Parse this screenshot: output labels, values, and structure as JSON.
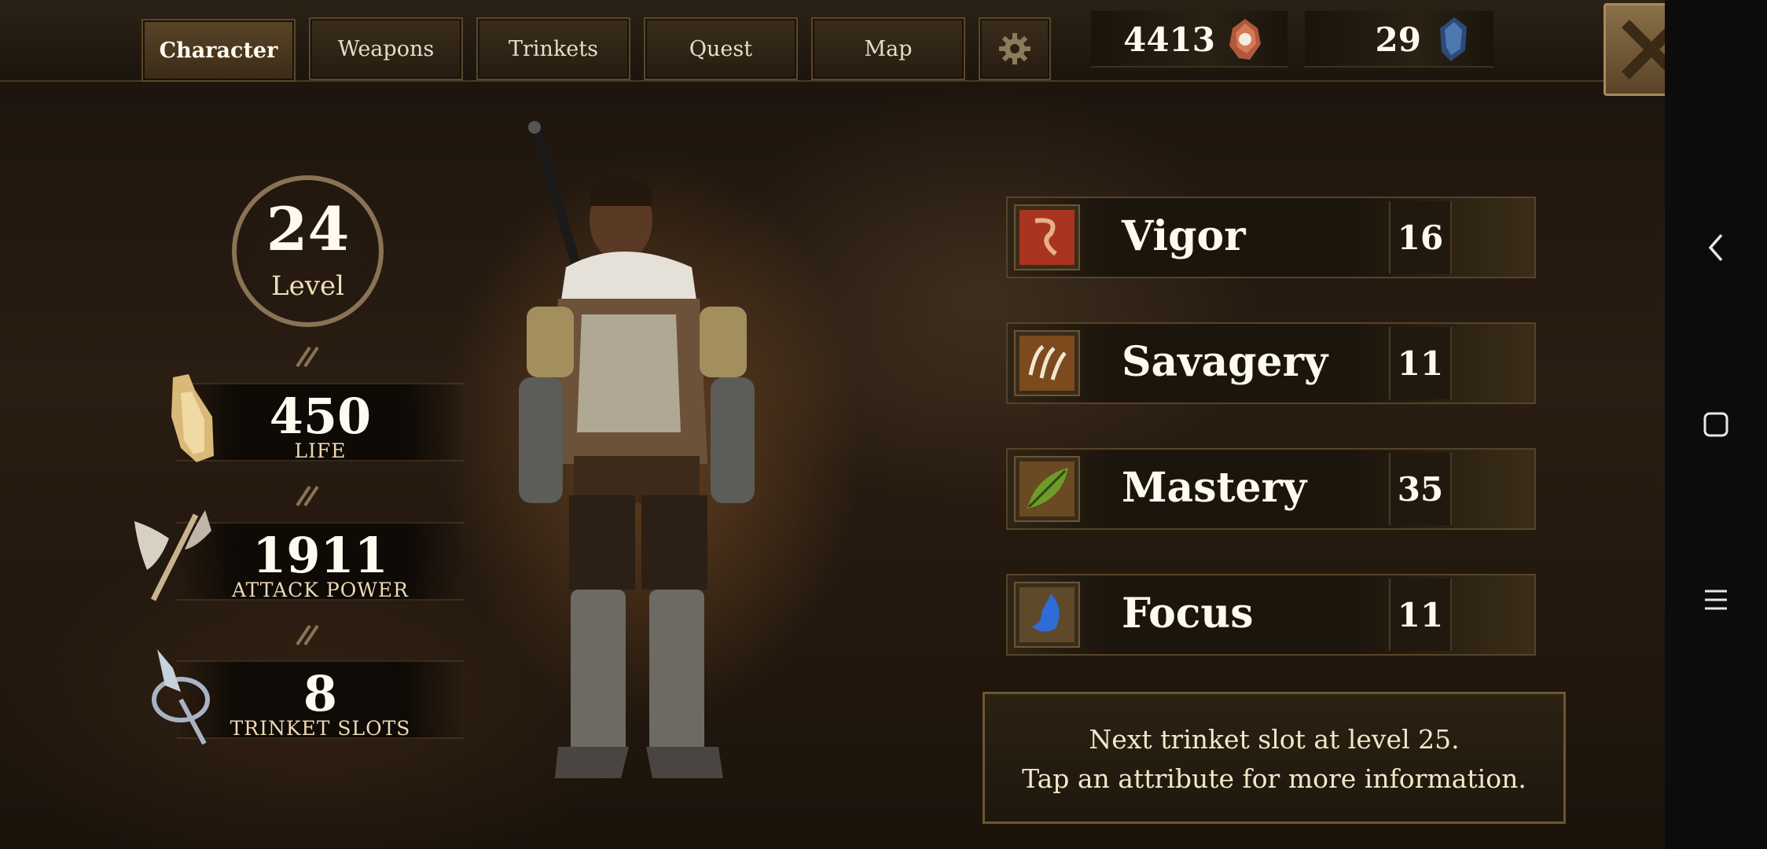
{
  "tabs": [
    {
      "label": "Character",
      "active": true
    },
    {
      "label": "Weapons",
      "active": false
    },
    {
      "label": "Trinkets",
      "active": false
    },
    {
      "label": "Quest",
      "active": false
    },
    {
      "label": "Map",
      "active": false
    }
  ],
  "currencies": {
    "gems": {
      "value": "4413",
      "icon": "red-gem-icon"
    },
    "crystals": {
      "value": "29",
      "icon": "blue-crystal-icon"
    }
  },
  "level": {
    "value": "24",
    "label": "Level"
  },
  "stats": [
    {
      "value": "450",
      "label": "LIFE",
      "icon": "gauntlet-icon"
    },
    {
      "value": "1911",
      "label": "ATTACK POWER",
      "icon": "axe-icon"
    },
    {
      "value": "8",
      "label": "TRINKET SLOTS",
      "icon": "trinket-icon"
    }
  ],
  "attributes": [
    {
      "name": "Vigor",
      "value": "16",
      "icon": "vigor-icon"
    },
    {
      "name": "Savagery",
      "value": "11",
      "icon": "claw-icon"
    },
    {
      "name": "Mastery",
      "value": "35",
      "icon": "leaf-icon"
    },
    {
      "name": "Focus",
      "value": "11",
      "icon": "focus-icon"
    }
  ],
  "info": {
    "line1": "Next trinket slot at level 25.",
    "line2": "Tap an attribute for more information."
  },
  "colors": {
    "accent": "#6e5532",
    "text": "#fffaf0"
  }
}
